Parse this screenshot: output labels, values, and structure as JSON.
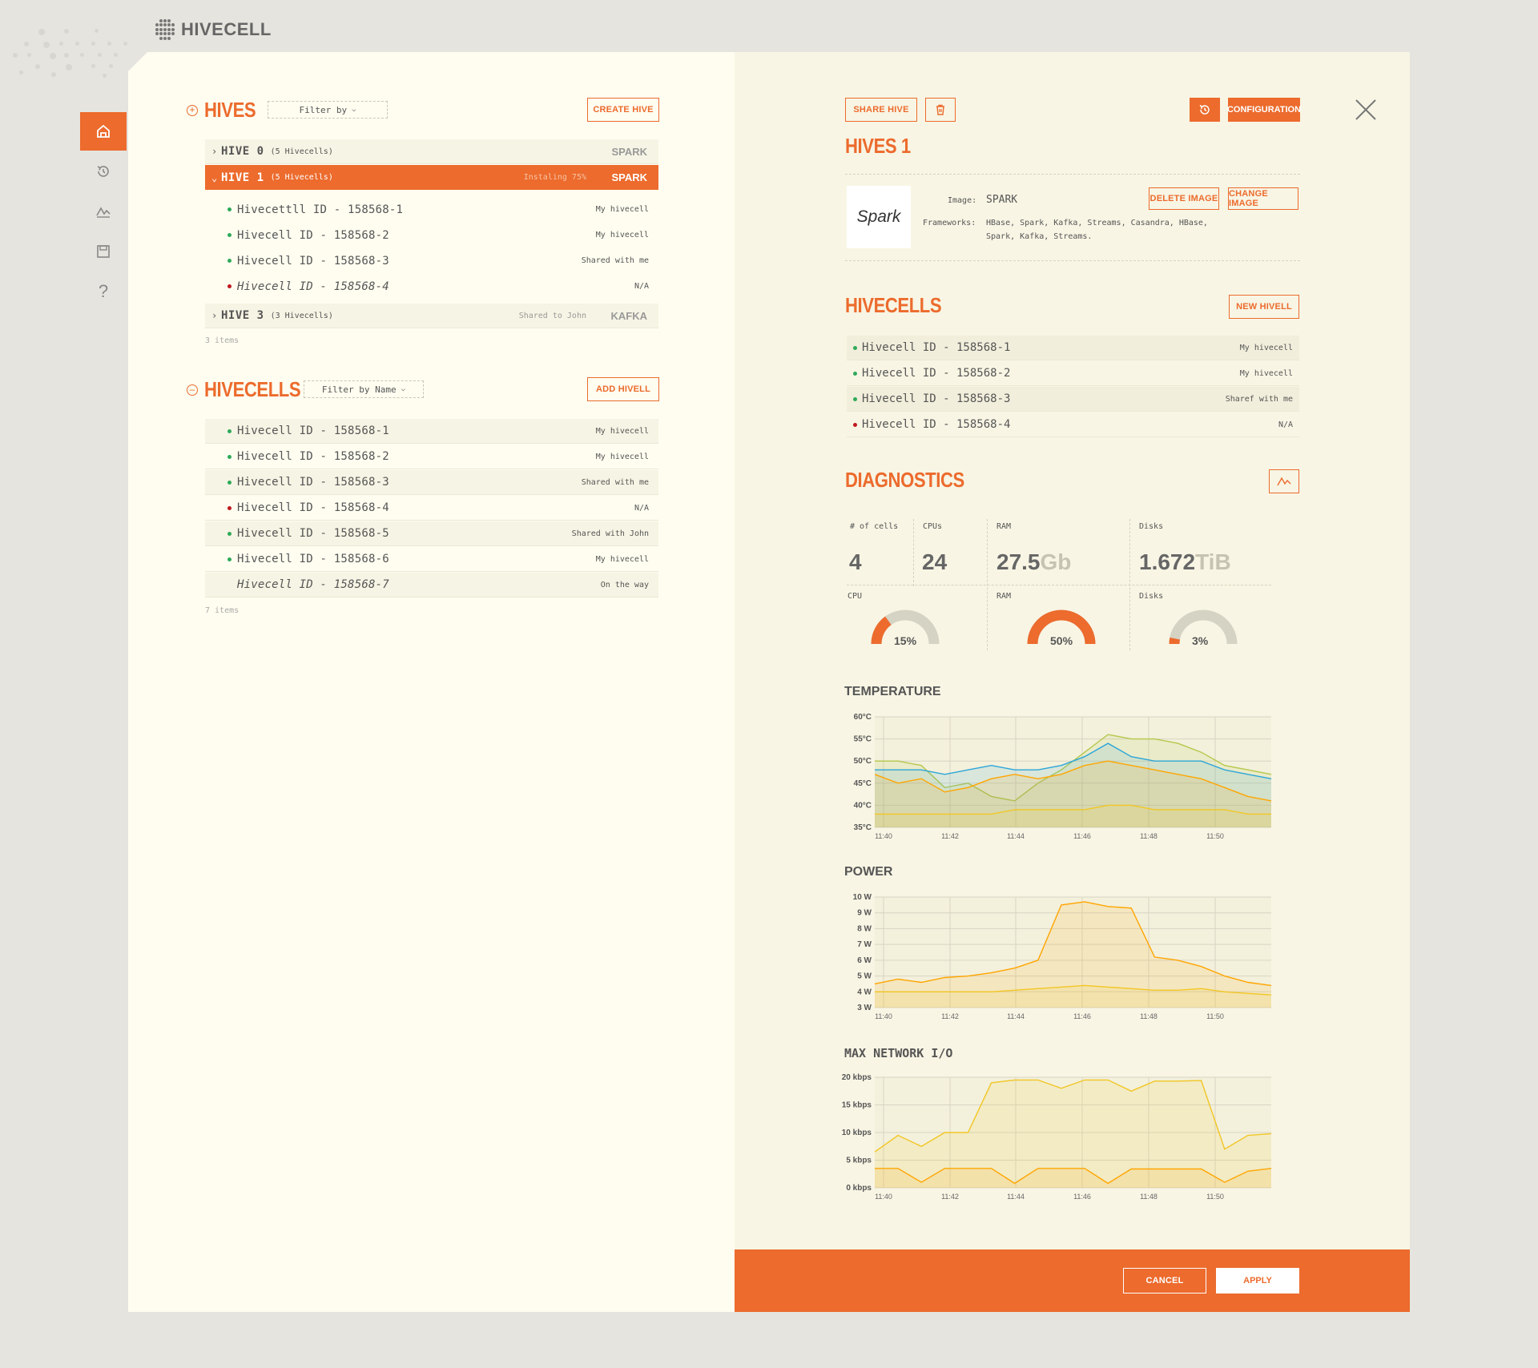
{
  "app": {
    "name": "HIVECELL"
  },
  "sidebar": {
    "items": [
      "home-icon",
      "history-icon",
      "activity-icon",
      "save-icon",
      "help-icon"
    ],
    "help_glyph": "?"
  },
  "hives_section": {
    "title": "HIVES",
    "filter_label": "Filter by",
    "create_label": "CREATE HIVE",
    "rows": [
      {
        "name": "HIVE 0",
        "count": "(5 Hivecells)",
        "status": "",
        "framework": "SPARK"
      },
      {
        "name": "HIVE 1",
        "count": "(5 Hivecells)",
        "status": "Instaling 75%",
        "framework": "SPARK"
      },
      {
        "name": "HIVE 3",
        "count": "(3 Hivecells)",
        "status": "Shared to John",
        "framework": "KAFKA"
      }
    ],
    "hive1_cells": [
      {
        "name": "Hivecettll ID - 158568-1",
        "owner": "My hivecell"
      },
      {
        "name": "Hivecell ID - 158568-2",
        "owner": "My hivecell"
      },
      {
        "name": "Hivecell ID - 158568-3",
        "owner": "Shared with me"
      },
      {
        "name": "Hivecell ID - 158568-4",
        "owner": "N/A"
      }
    ],
    "count_label": "3 items"
  },
  "hivecells_section": {
    "title": "HIVECELLS",
    "filter_label": "Filter by Name",
    "add_label": "ADD HIVELL",
    "rows": [
      {
        "name": "Hivecell ID - 158568-1",
        "owner": "My hivecell"
      },
      {
        "name": "Hivecell ID - 158568-2",
        "owner": "My hivecell"
      },
      {
        "name": "Hivecell ID - 158568-3",
        "owner": "Shared with me"
      },
      {
        "name": "Hivecell ID - 158568-4",
        "owner": "N/A"
      },
      {
        "name": "Hivecell ID - 158568-5",
        "owner": "Shared with John"
      },
      {
        "name": "Hivecell ID - 158568-6",
        "owner": "My hivecell"
      },
      {
        "name": "Hivecell ID - 158568-7",
        "owner": "On the way"
      }
    ],
    "count_label": "7 items"
  },
  "detail": {
    "share_label": "SHARE HIVE",
    "config_label": "CONFIGURATION",
    "title": "HIVES 1",
    "logo_text": "Spark",
    "image_label": "Image:",
    "image_value": "SPARK",
    "delete_image_label": "DELETE IMAGE",
    "change_image_label": "CHANGE IMAGE",
    "frameworks_label": "Frameworks:",
    "frameworks_line1": "HBase, Spark, Kafka, Streams, Casandra, HBase,",
    "frameworks_line2": "Spark, Kafka, Streams.",
    "hivecells_title": "HIVECELLS",
    "new_hivell_label": "NEW HIVELL",
    "hivecells": [
      {
        "name": "Hivecell ID - 158568-1",
        "owner": "My hivecell"
      },
      {
        "name": "Hivecell ID - 158568-2",
        "owner": "My hivecell"
      },
      {
        "name": "Hivecell ID - 158568-3",
        "owner": "Sharef with me"
      },
      {
        "name": "Hivecell ID - 158568-4",
        "owner": "N/A"
      }
    ],
    "diagnostics_title": "DIAGNOSTICS",
    "stats": {
      "cells_label": "# of cells",
      "cells_value": "4",
      "cpus_label": "CPUs",
      "cpus_value": "24",
      "ram_label": "RAM",
      "ram_value": "27.5",
      "ram_unit": "Gb",
      "disks_label": "Disks",
      "disks_value": "1.672",
      "disks_unit": "TiB"
    },
    "gauges": [
      {
        "label": "CPU",
        "value": 15,
        "text": "15%"
      },
      {
        "label": "RAM",
        "value": 50,
        "text": "50%"
      },
      {
        "label": "Disks",
        "value": 3,
        "text": "3%"
      }
    ],
    "cancel_label": "CANCEL",
    "apply_label": "APPLY"
  },
  "colors": {
    "accent": "#ec6b2d",
    "green": "#2eaa5a",
    "red": "#c0181e",
    "blue": "#2ba6d9",
    "lime": "#b5c84a",
    "yellow": "#f2c623"
  },
  "chart_data": [
    {
      "type": "area",
      "title": "TEMPERATURE",
      "x": [
        "11:40",
        "11:42",
        "11:44",
        "11:46",
        "11:48",
        "11:50"
      ],
      "yticks": [
        "35°C",
        "40°C",
        "45°C",
        "50°C",
        "55°C",
        "60°C"
      ],
      "ylim": [
        35,
        60
      ],
      "series": [
        {
          "color": "lime",
          "values": [
            50,
            50,
            49,
            44,
            45,
            42,
            41,
            45,
            48,
            52,
            56,
            55,
            55,
            54,
            52,
            49,
            48,
            47
          ]
        },
        {
          "color": "blue",
          "values": [
            48,
            48,
            48,
            47,
            48,
            49,
            48,
            48,
            49,
            51,
            54,
            51,
            50,
            50,
            50,
            48,
            47,
            46
          ]
        },
        {
          "color": "orange",
          "values": [
            47,
            45,
            46,
            43,
            44,
            46,
            47,
            46,
            47,
            49,
            50,
            49,
            48,
            47,
            46,
            44,
            42,
            41
          ]
        },
        {
          "color": "yellow",
          "values": [
            38,
            38,
            38,
            38,
            38,
            38,
            39,
            39,
            39,
            39,
            40,
            40,
            39,
            39,
            39,
            39,
            38,
            38
          ]
        }
      ],
      "grid": true
    },
    {
      "type": "area",
      "title": "POWER",
      "x": [
        "11:40",
        "11:42",
        "11:44",
        "11:46",
        "11:48",
        "11:50"
      ],
      "yticks": [
        "3 W",
        "4 W",
        "5 W",
        "6 W",
        "7 W",
        "8 W",
        "9 W",
        "10 W"
      ],
      "ylim": [
        3,
        10
      ],
      "series": [
        {
          "color": "orange",
          "values": [
            4.5,
            4.8,
            4.6,
            4.9,
            5.0,
            5.2,
            5.5,
            6.0,
            9.5,
            9.7,
            9.4,
            9.3,
            6.2,
            6.0,
            5.6,
            5.0,
            4.6,
            4.4
          ]
        },
        {
          "color": "yellow",
          "values": [
            4.0,
            4.0,
            4.0,
            4.0,
            4.0,
            4.0,
            4.1,
            4.2,
            4.3,
            4.4,
            4.3,
            4.2,
            4.1,
            4.1,
            4.2,
            4.0,
            3.9,
            3.8
          ]
        }
      ],
      "grid": true
    },
    {
      "type": "area",
      "title": "MAX NETWORK I/O",
      "x": [
        "11:40",
        "11:42",
        "11:44",
        "11:46",
        "11:48",
        "11:50"
      ],
      "yticks": [
        "0 kbps",
        "5 kbps",
        "10 kbps",
        "15 kbps",
        "20 kbps"
      ],
      "ylim": [
        0,
        20
      ],
      "series": [
        {
          "color": "yellow",
          "values": [
            6.5,
            9.5,
            7.5,
            10,
            10,
            19,
            19.5,
            19.5,
            18,
            19.5,
            19.5,
            17.5,
            19.3,
            19.3,
            19.4,
            7,
            9.5,
            9.8
          ]
        },
        {
          "color": "orange",
          "values": [
            3.5,
            3.5,
            1,
            3.5,
            3.5,
            3.5,
            0.8,
            3.5,
            3.5,
            3.5,
            0.8,
            3.4,
            3.4,
            3.4,
            3.4,
            1,
            3,
            3.5
          ]
        }
      ],
      "grid": true
    }
  ]
}
